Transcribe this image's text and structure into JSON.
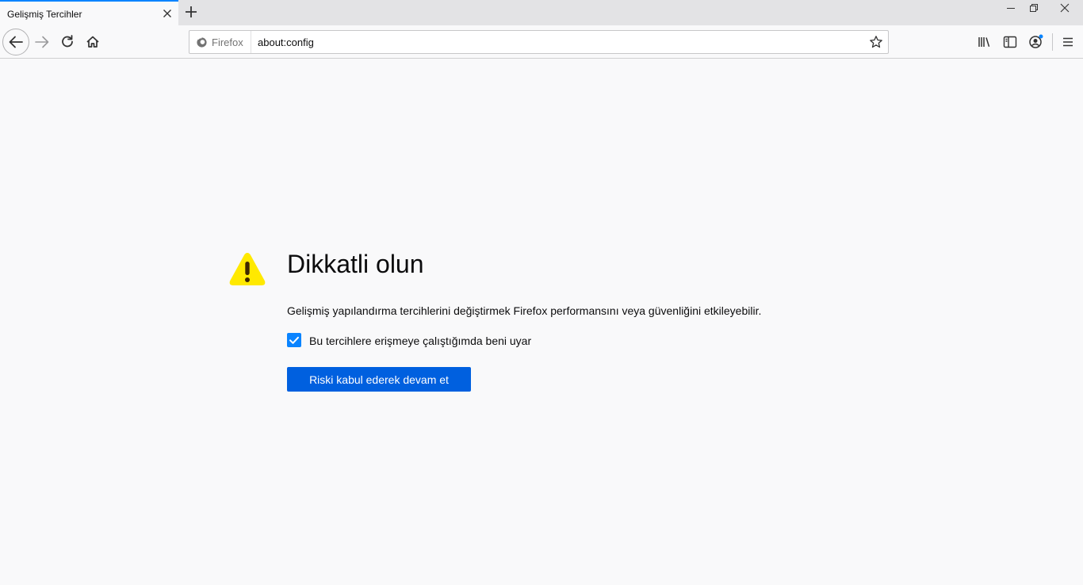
{
  "tab": {
    "title": "Gelişmiş Tercihler"
  },
  "urlbar": {
    "identity_label": "Firefox",
    "url": "about:config"
  },
  "warning": {
    "title": "Dikkatli olun",
    "description": "Gelişmiş yapılandırma tercihlerini değiştirmek Firefox performansını veya güvenliğini etkileyebilir.",
    "checkbox_label": "Bu tercihlere erişmeye çalıştığımda beni uyar",
    "checkbox_checked": true,
    "accept_button": "Riski kabul ederek devam et"
  },
  "colors": {
    "accent": "#0a84ff",
    "button": "#0060df",
    "warning_yellow": "#ffe900"
  },
  "icons": [
    "close-icon",
    "plus-icon",
    "minimize-icon",
    "restore-icon",
    "back-icon",
    "forward-icon",
    "reload-icon",
    "home-icon",
    "firefox-icon",
    "star-icon",
    "library-icon",
    "sidebar-icon",
    "account-icon",
    "menu-icon",
    "warning-icon",
    "check-icon"
  ]
}
